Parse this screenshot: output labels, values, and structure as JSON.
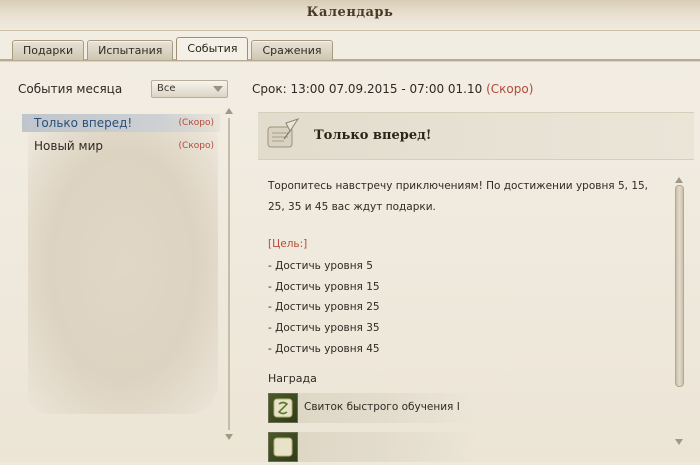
{
  "window": {
    "title": "Календарь"
  },
  "tabs": [
    {
      "label": "Подарки",
      "active": false
    },
    {
      "label": "Испытания",
      "active": false
    },
    {
      "label": "События",
      "active": true
    },
    {
      "label": "Сражения",
      "active": false
    }
  ],
  "left_panel": {
    "filter_label": "События месяца",
    "filter_value": "Все",
    "events": [
      {
        "name": "Только вперед!",
        "status": "(Скоро)",
        "selected": true
      },
      {
        "name": "Новый мир",
        "status": "(Скоро)",
        "selected": false
      }
    ]
  },
  "details": {
    "period_label": "Срок: 13:00 07.09.2015 - 07:00 01.10",
    "period_status": "(Скоро)",
    "title": "Только вперед!",
    "description": "Торопитесь навстречу приключениям! По достижении уровня 5, 15, 25, 35 и 45 вас ждут подарки.",
    "goal_label": "[Цель:]",
    "goals": [
      "- Достичь уровня 5",
      "- Достичь уровня 15",
      "- Достичь уровня 25",
      "- Достичь уровня 35",
      "- Достичь уровня 45"
    ],
    "reward_label": "Награда",
    "rewards": [
      {
        "name": "Свиток быстрого обучения I",
        "icon": "scroll-green-icon"
      },
      {
        "name": "",
        "icon": "scroll-green-icon"
      }
    ]
  },
  "colors": {
    "soon_red": "#b44a3a",
    "selected_blue": "#2a4f7a"
  }
}
